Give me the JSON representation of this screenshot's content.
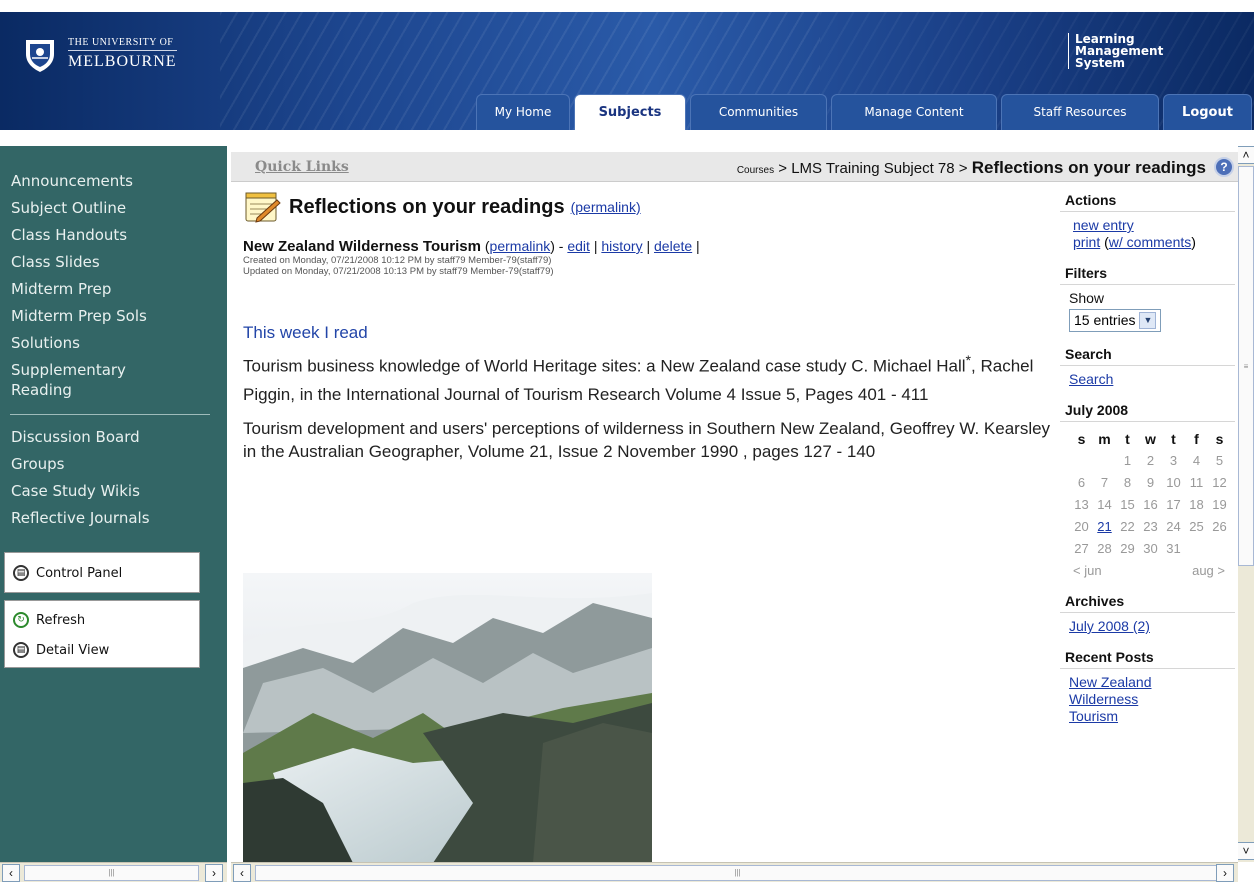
{
  "header": {
    "logo_line1": "THE UNIVERSITY OF",
    "logo_line2": "MELBOURNE",
    "lms_line1": "Learning",
    "lms_line2": "Management",
    "lms_line3": "System",
    "tabs": [
      {
        "label": "My Home"
      },
      {
        "label": "Subjects"
      },
      {
        "label": "Communities"
      },
      {
        "label": "Manage Content"
      },
      {
        "label": "Staff Resources"
      },
      {
        "label": "Logout"
      }
    ]
  },
  "sidebar": {
    "items": [
      {
        "label": "Announcements"
      },
      {
        "label": "Subject Outline"
      },
      {
        "label": "Class Handouts"
      },
      {
        "label": "Class Slides"
      },
      {
        "label": "Midterm Prep"
      },
      {
        "label": "Midterm Prep Sols"
      },
      {
        "label": "Solutions"
      },
      {
        "label": "Supplementary Reading"
      }
    ],
    "items2": [
      {
        "label": "Discussion Board"
      },
      {
        "label": "Groups"
      },
      {
        "label": "Case Study Wikis"
      },
      {
        "label": "Reflective Journals"
      }
    ],
    "control_panel": "Control Panel",
    "refresh": "Refresh",
    "detail_view": "Detail View"
  },
  "breadcrumb": {
    "quick_links": "Quick Links",
    "courses": "Courses",
    "sep": ">",
    "subject": "LMS Training Subject 78",
    "current": "Reflections on your readings"
  },
  "main": {
    "title": "Reflections on your readings",
    "permalink": "(permalink)",
    "entry_title": "New Zealand Wilderness Tourism",
    "entry_permalink": "permalink",
    "edit": "edit",
    "history": "history",
    "delete": "delete",
    "created": "Created on Monday, 07/21/2008 10:12 PM by staff79 Member-79(staff79)",
    "updated": "Updated on Monday, 07/21/2008 10:13 PM by staff79 Member-79(staff79)",
    "heading": "This week I read",
    "para1a": "Tourism business knowledge of World Heritage sites: a New Zealand case study C. Michael Hall",
    "para1_sup": "*",
    "para1b": ", Rachel Piggin, in the International Journal of Tourism Research Volume 4 Issue 5, Pages 401 - 411",
    "para2": "Tourism development and users' perceptions of wilderness in Southern New Zealand, Geoffrey W. Kearsley in the Australian Geographer, Volume 21, Issue 2 November 1990 , pages 127 - 140"
  },
  "right": {
    "actions": "Actions",
    "new_entry": "new entry",
    "print": "print",
    "w_comments": "w/ comments",
    "filters": "Filters",
    "show": "Show",
    "show_value": "15 entries",
    "search_heading": "Search",
    "search_link": "Search",
    "calendar_title": "July 2008",
    "weekdays": [
      "s",
      "m",
      "t",
      "w",
      "t",
      "f",
      "s"
    ],
    "weeks": [
      [
        "",
        "",
        "1",
        "2",
        "3",
        "4",
        "5"
      ],
      [
        "6",
        "7",
        "8",
        "9",
        "10",
        "11",
        "12"
      ],
      [
        "13",
        "14",
        "15",
        "16",
        "17",
        "18",
        "19"
      ],
      [
        "20",
        "21",
        "22",
        "23",
        "24",
        "25",
        "26"
      ],
      [
        "27",
        "28",
        "29",
        "30",
        "31",
        "",
        ""
      ]
    ],
    "prev_month": "< jun",
    "next_month": "aug >",
    "archives": "Archives",
    "archive_item": "July 2008 (2)",
    "recent_posts": "Recent Posts",
    "recent_item": "New Zealand Wilderness Tourism"
  },
  "icons": {
    "help": "help-icon",
    "control_panel": "control-panel-icon",
    "refresh": "refresh-icon",
    "detail_view": "detail-view-icon"
  },
  "colors": {
    "sidebar": "#336666",
    "banner": "#1d468f",
    "link": "#1b3aa6"
  }
}
